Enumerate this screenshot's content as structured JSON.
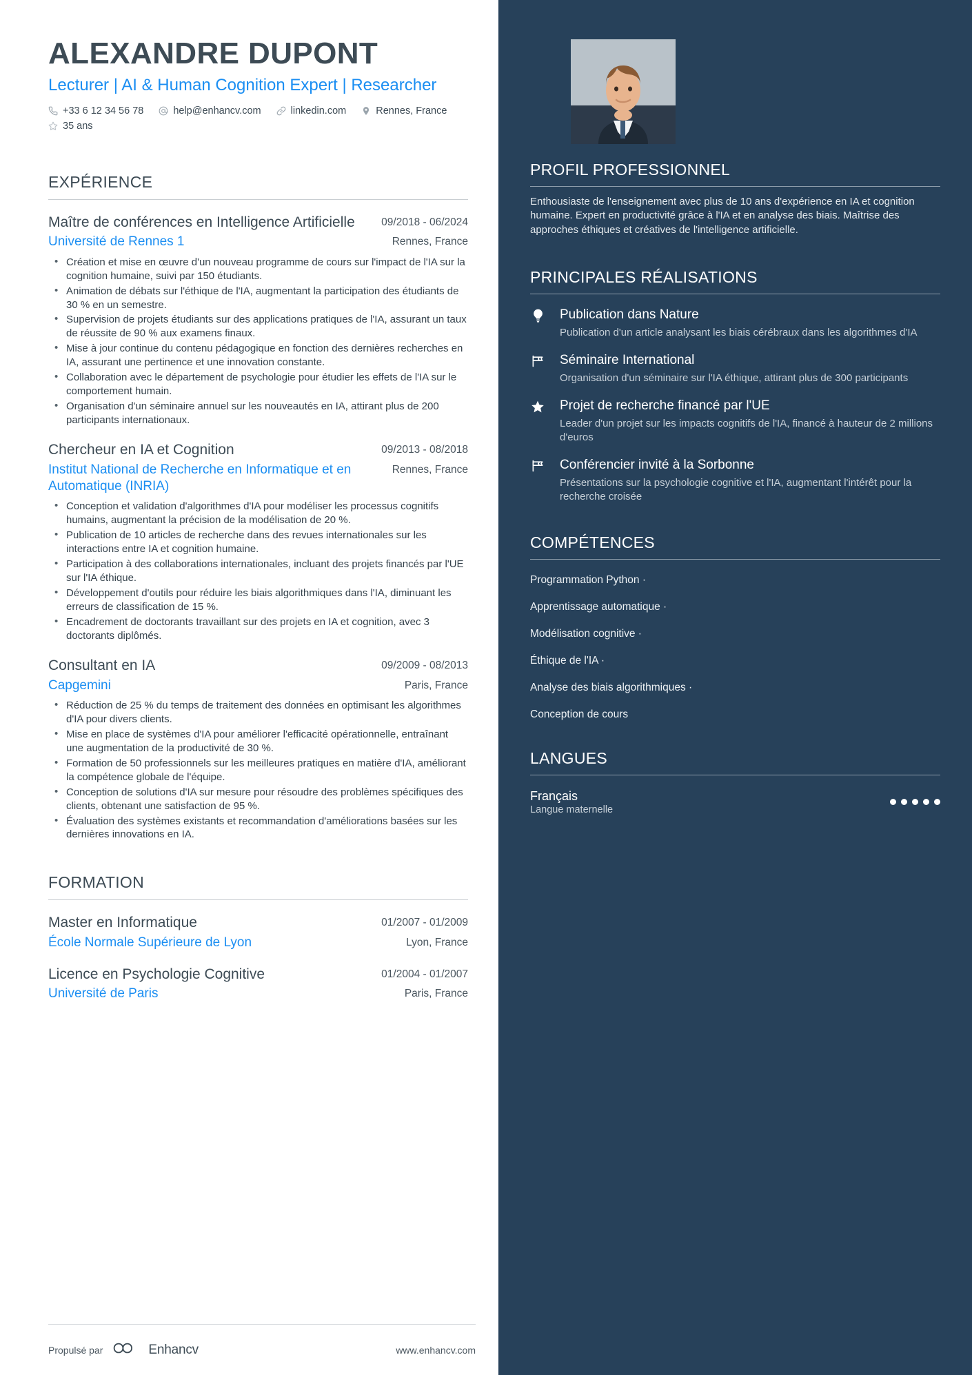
{
  "colors": {
    "sidebar_bg": "#27415A",
    "accent_blue": "#1B8EF2",
    "heading_dark": "#3D4B55",
    "body_text": "#35424C"
  },
  "header": {
    "name": "ALEXANDRE DUPONT",
    "headline": "Lecturer | AI & Human Cognition Expert | Researcher",
    "contacts": [
      {
        "icon": "phone-icon",
        "text": "+33 6 12 34 56 78"
      },
      {
        "icon": "email-icon",
        "text": "help@enhancv.com"
      },
      {
        "icon": "link-icon",
        "text": "linkedin.com"
      },
      {
        "icon": "location-pin-icon",
        "text": "Rennes, France"
      },
      {
        "icon": "star-icon",
        "text": "35 ans"
      }
    ]
  },
  "experience": {
    "title": "EXPÉRIENCE",
    "entries": [
      {
        "role": "Maître de conférences en Intelligence Artificielle",
        "date": "09/2018 - 06/2024",
        "org": "Université de Rennes 1",
        "location": "Rennes, France",
        "bullets": [
          "Création et mise en œuvre d'un nouveau programme de cours sur l'impact de l'IA sur la cognition humaine, suivi par 150 étudiants.",
          "Animation de débats sur l'éthique de l'IA, augmentant la participation des étudiants de 30 % en un semestre.",
          "Supervision de projets étudiants sur des applications pratiques de l'IA, assurant un taux de réussite de 90 % aux examens finaux.",
          "Mise à jour continue du contenu pédagogique en fonction des dernières recherches en IA, assurant une pertinence et une innovation constante.",
          "Collaboration avec le département de psychologie pour étudier les effets de l'IA sur le comportement humain.",
          "Organisation d'un séminaire annuel sur les nouveautés en IA, attirant plus de 200 participants internationaux."
        ]
      },
      {
        "role": "Chercheur en IA et Cognition",
        "date": "09/2013 - 08/2018",
        "org": "Institut National de Recherche en Informatique et en Automatique (INRIA)",
        "location": "Rennes, France",
        "bullets": [
          "Conception et validation d'algorithmes d'IA pour modéliser les processus cognitifs humains, augmentant la précision de la modélisation de 20 %.",
          "Publication de 10 articles de recherche dans des revues internationales sur les interactions entre IA et cognition humaine.",
          "Participation à des collaborations internationales, incluant des projets financés par l'UE sur l'IA éthique.",
          "Développement d'outils pour réduire les biais algorithmiques dans l'IA, diminuant les erreurs de classification de 15 %.",
          "Encadrement de doctorants travaillant sur des projets en IA et cognition, avec 3 doctorants diplômés."
        ]
      },
      {
        "role": "Consultant en IA",
        "date": "09/2009 - 08/2013",
        "org": "Capgemini",
        "location": "Paris, France",
        "bullets": [
          "Réduction de 25 % du temps de traitement des données en optimisant les algorithmes d'IA pour divers clients.",
          "Mise en place de systèmes d'IA pour améliorer l'efficacité opérationnelle, entraînant une augmentation de la productivité de 30 %.",
          "Formation de 50 professionnels sur les meilleures pratiques en matière d'IA, améliorant la compétence globale de l'équipe.",
          "Conception de solutions d'IA sur mesure pour résoudre des problèmes spécifiques des clients, obtenant une satisfaction de 95 %.",
          "Évaluation des systèmes existants et recommandation d'améliorations basées sur les dernières innovations en IA."
        ]
      }
    ]
  },
  "education": {
    "title": "FORMATION",
    "entries": [
      {
        "degree": "Master en Informatique",
        "date": "01/2007 - 01/2009",
        "school": "École Normale Supérieure de Lyon",
        "location": "Lyon, France"
      },
      {
        "degree": "Licence en Psychologie Cognitive",
        "date": "01/2004 - 01/2007",
        "school": "Université de Paris",
        "location": "Paris, France"
      }
    ]
  },
  "sidebar": {
    "profile": {
      "title": "PROFIL PROFESSIONNEL",
      "text": "Enthousiaste de l'enseignement avec plus de 10 ans d'expérience en IA et cognition humaine. Expert en productivité grâce à l'IA et en analyse des biais. Maîtrise des approches éthiques et créatives de l'intelligence artificielle."
    },
    "achievements": {
      "title": "PRINCIPALES RÉALISATIONS",
      "items": [
        {
          "icon": "lightbulb-icon",
          "title": "Publication dans Nature",
          "desc": "Publication d'un article analysant les biais cérébraux dans les algorithmes d'IA"
        },
        {
          "icon": "flag-icon",
          "title": "Séminaire International",
          "desc": "Organisation d'un séminaire sur l'IA éthique, attirant plus de 300 participants"
        },
        {
          "icon": "star-filled-icon",
          "title": "Projet de recherche financé par l'UE",
          "desc": "Leader d'un projet sur les impacts cognitifs de l'IA, financé à hauteur de 2 millions d'euros"
        },
        {
          "icon": "flag-icon",
          "title": "Conférencier invité à la Sorbonne",
          "desc": "Présentations sur la psychologie cognitive et l'IA, augmentant l'intérêt pour la recherche croisée"
        }
      ]
    },
    "skills": {
      "title": "COMPÉTENCES",
      "items": [
        "Programmation Python ·",
        "Apprentissage automatique ·",
        "Modélisation cognitive ·",
        "Éthique de l'IA ·",
        "Analyse des biais algorithmiques ·",
        "Conception de cours"
      ]
    },
    "languages": {
      "title": "LANGUES",
      "items": [
        {
          "name": "Français",
          "level": "Langue maternelle",
          "dots_filled": 5,
          "dots_total": 5
        }
      ]
    }
  },
  "footer": {
    "powered_by": "Propulsé par",
    "brand": "Enhancv",
    "url": "www.enhancv.com"
  }
}
